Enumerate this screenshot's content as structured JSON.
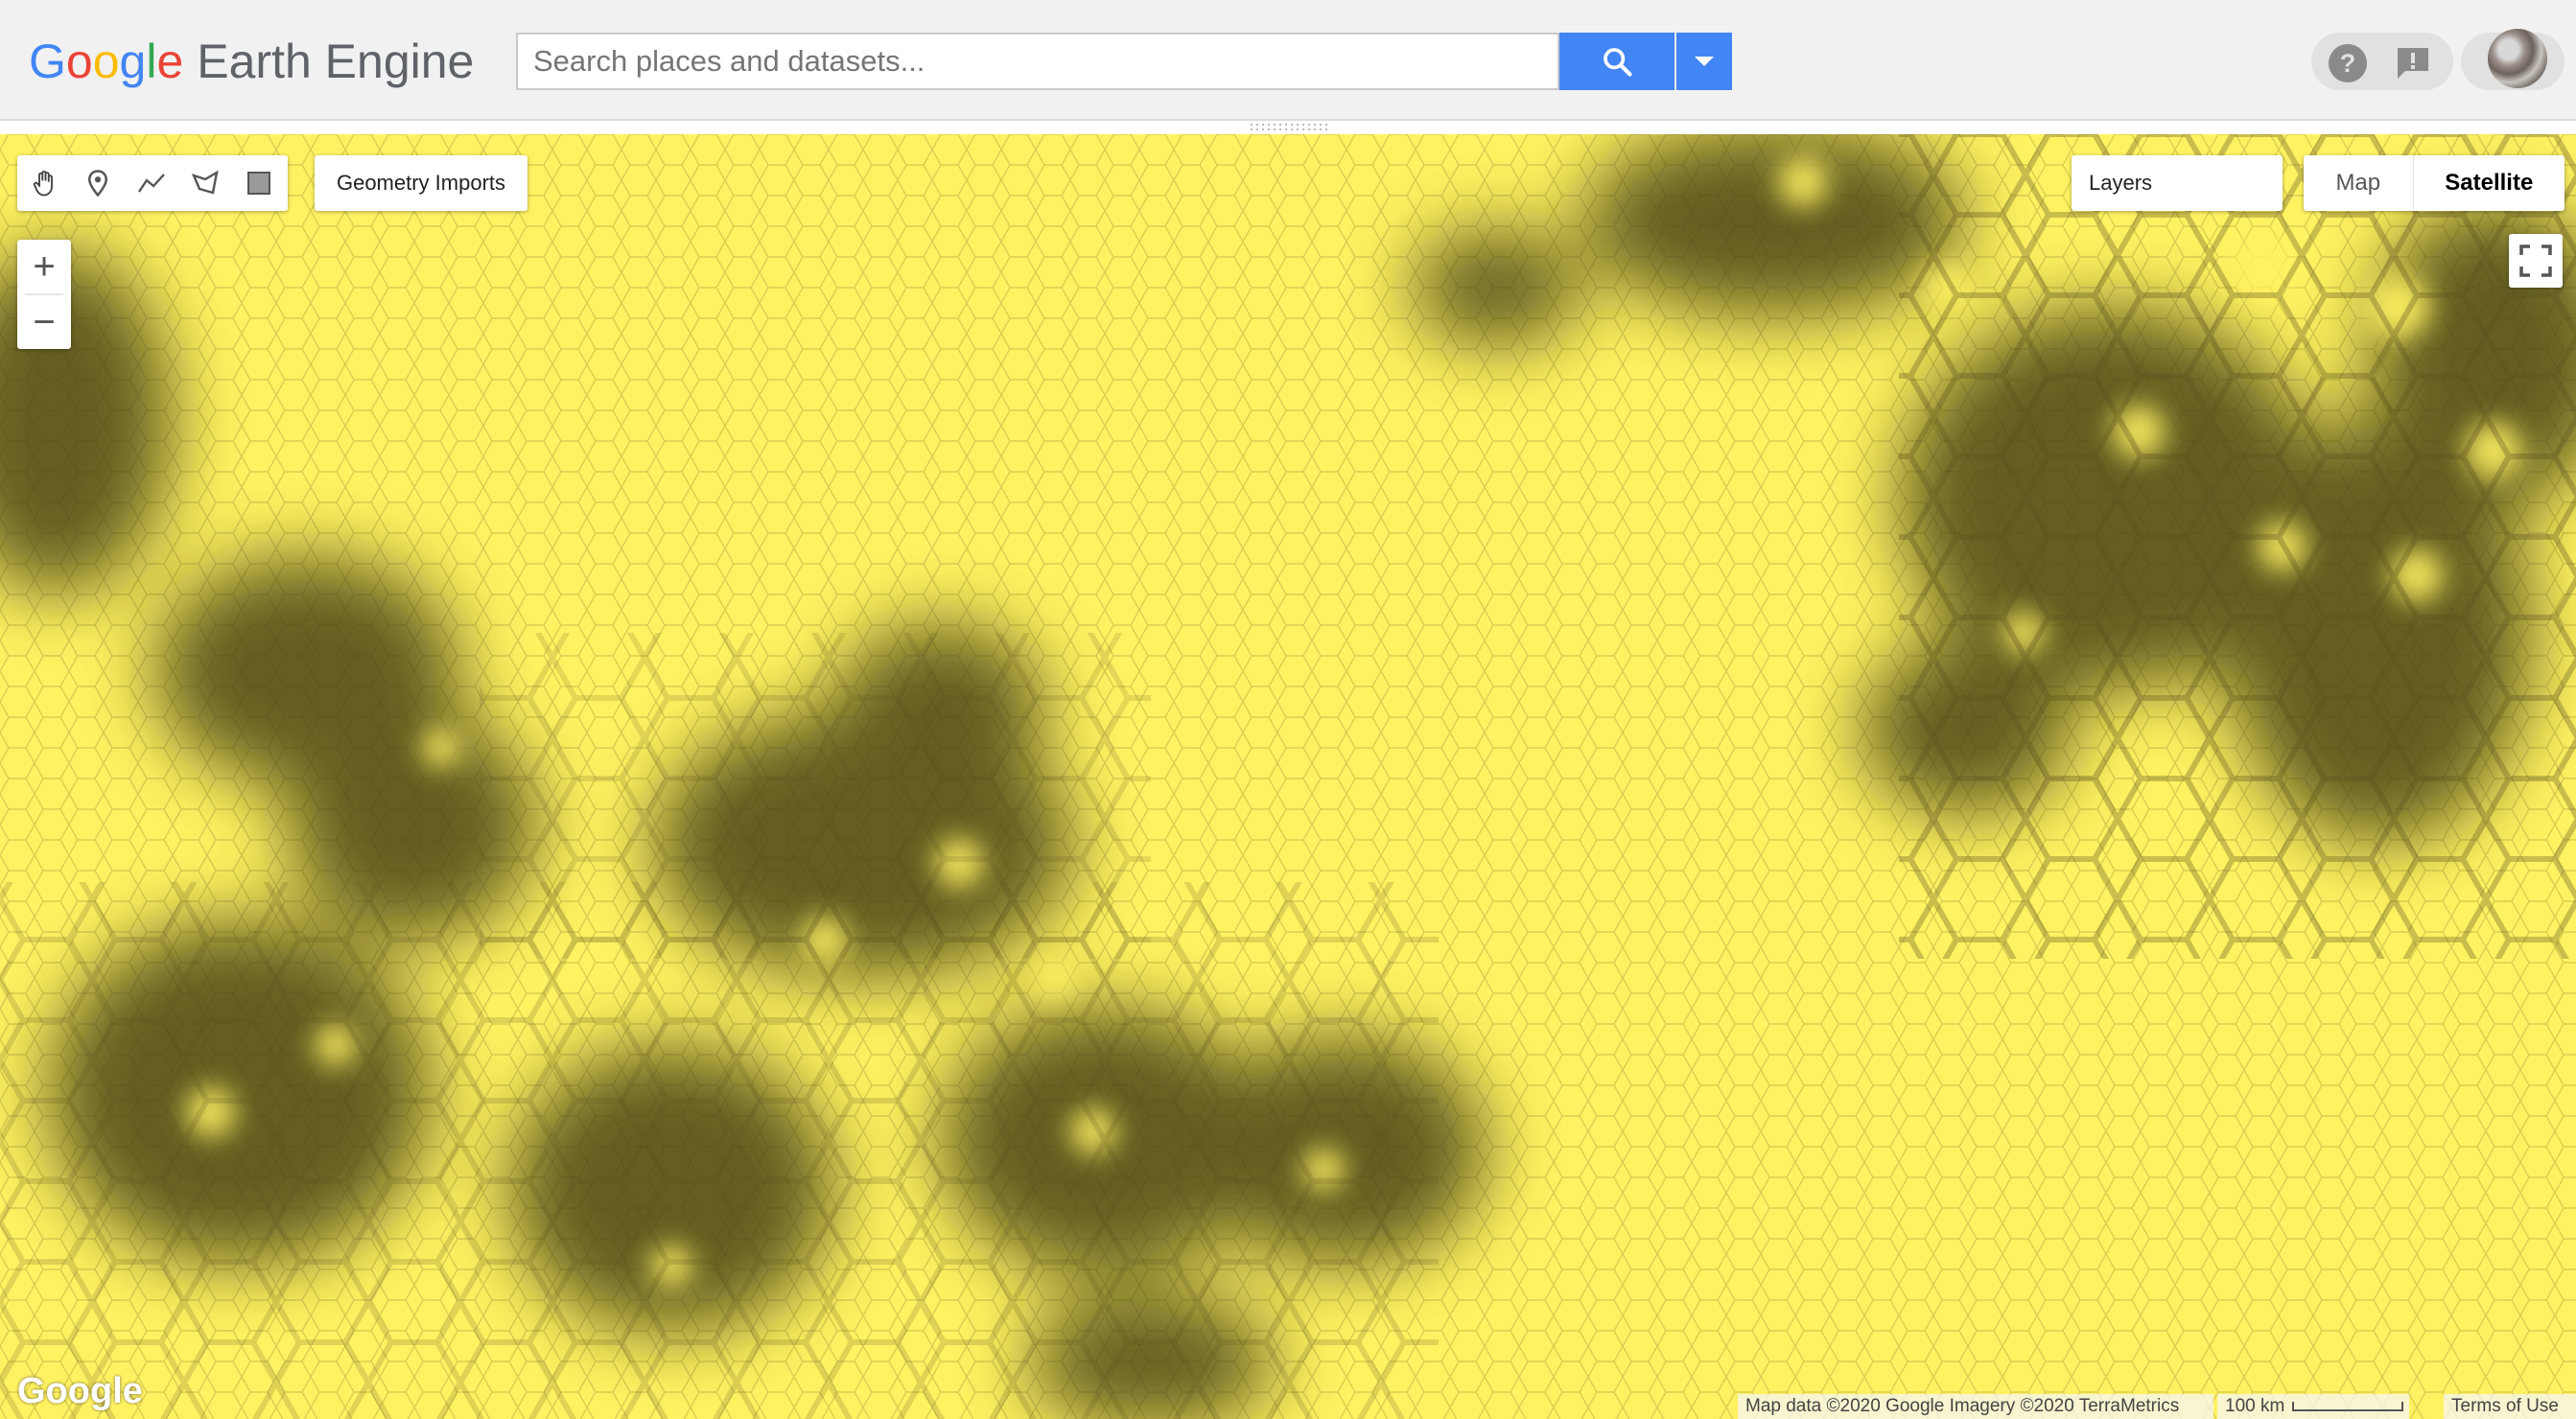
{
  "header": {
    "logo_google": [
      "G",
      "o",
      "o",
      "g",
      "l",
      "e"
    ],
    "logo_google_colors": [
      "#4285f4",
      "#ea4335",
      "#fbbc05",
      "#4285f4",
      "#34a853",
      "#ea4335"
    ],
    "logo_product": "Earth Engine",
    "search_placeholder": "Search places and datasets...",
    "icons": {
      "search": "search-icon",
      "dropdown": "caret-down-icon",
      "help": "help-icon",
      "feedback": "feedback-icon",
      "avatar": "avatar"
    },
    "accent_color": "#4285f4"
  },
  "map": {
    "drawing_tools": [
      {
        "name": "hand-tool-icon",
        "label": ""
      },
      {
        "name": "point-tool-icon",
        "label": ""
      },
      {
        "name": "line-tool-icon",
        "label": ""
      },
      {
        "name": "polygon-tool-icon",
        "label": ""
      },
      {
        "name": "rectangle-tool-icon",
        "label": ""
      }
    ],
    "geometry_imports_label": "Geometry Imports",
    "zoom_in_label": "+",
    "zoom_out_label": "−",
    "layers_label": "Layers",
    "map_type": {
      "map_label": "Map",
      "satellite_label": "Satellite",
      "selected": "Satellite"
    },
    "google_watermark": "Google",
    "attribution": "Map data ©2020 Google Imagery ©2020 TerraMetrics",
    "scale_label": "100 km",
    "terms_label": "Terms of Use",
    "layer_colors": {
      "base": "#fff262",
      "dark": "#4a4418"
    }
  }
}
